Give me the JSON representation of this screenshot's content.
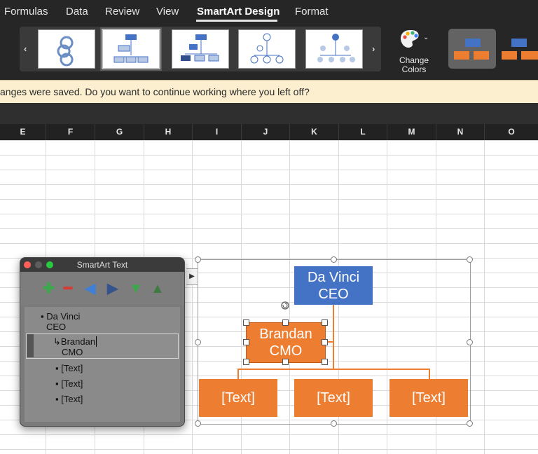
{
  "ribbon": {
    "tabs": [
      "Formulas",
      "Data",
      "Review",
      "View",
      "SmartArt Design",
      "Format"
    ],
    "active_tab": "SmartArt Design",
    "gallery_prev": "‹",
    "gallery_next": "›",
    "change_colors_line1": "Change",
    "change_colors_line2": "Colors"
  },
  "notice": {
    "text": "anges were saved. Do you want to continue working where you left off?"
  },
  "sheet": {
    "columns": [
      "E",
      "F",
      "G",
      "H",
      "I",
      "J",
      "K",
      "L",
      "M",
      "N",
      "O"
    ]
  },
  "pane": {
    "title": "SmartArt Text",
    "tools": [
      "add-icon",
      "remove-icon",
      "promote-icon",
      "demote-icon",
      "move-down-icon",
      "move-up-icon"
    ],
    "items": [
      {
        "line1": "Da Vinci",
        "line2": "CEO"
      },
      {
        "line1": "Brandan",
        "line2": "CMO"
      },
      {
        "line1": "[Text]"
      },
      {
        "line1": "[Text]"
      },
      {
        "line1": "[Text]"
      }
    ]
  },
  "smartart": {
    "ceo": {
      "line1": "Da Vinci",
      "line2": "CEO"
    },
    "assistant": {
      "line1": "Brandan",
      "line2": "CMO"
    },
    "children": [
      "[Text]",
      "[Text]",
      "[Text]"
    ]
  },
  "colors": {
    "ribbon_bg": "#262626",
    "notice_bg": "#fbefcf",
    "ceo_fill": "#4472c4",
    "orange_fill": "#ed7d31"
  }
}
